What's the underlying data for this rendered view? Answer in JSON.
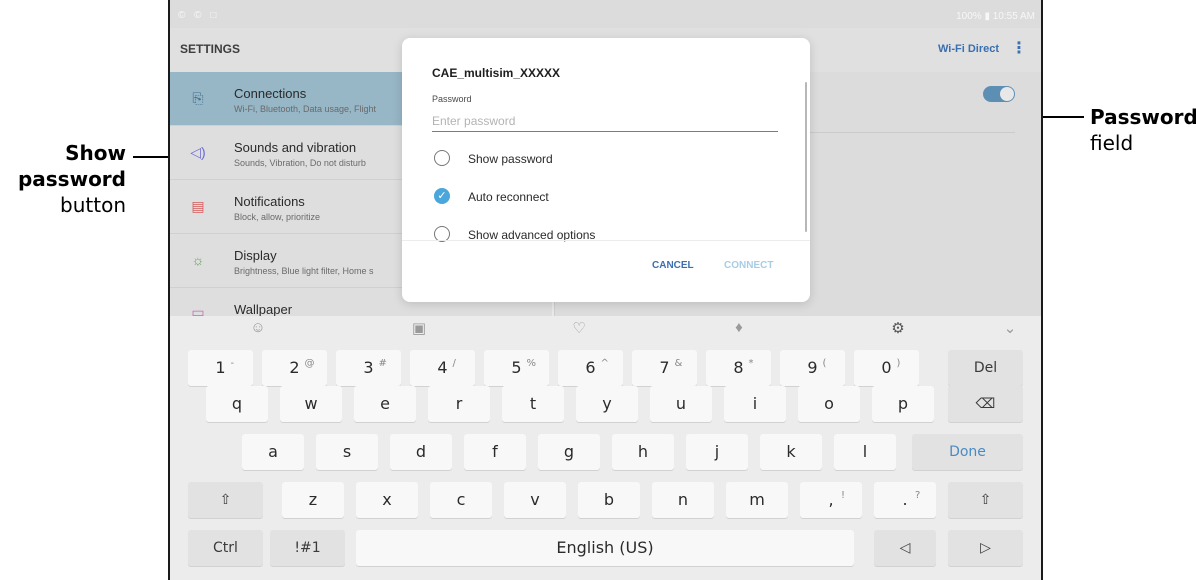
{
  "callouts": {
    "show_password": {
      "bold_line1": "Show",
      "bold_line2": "password",
      "normal": "button"
    },
    "password_field": {
      "bold": "Password",
      "normal": "field"
    }
  },
  "status_bar": {
    "left_icons": "© © □",
    "right": "100% ▮ 10:55 AM"
  },
  "settings": {
    "title": "SETTINGS",
    "wifi_direct": "Wi-Fi Direct",
    "items": [
      {
        "title": "Connections",
        "subtitle": "Wi-Fi, Bluetooth, Data usage, Flight",
        "icon": "connections-icon"
      },
      {
        "title": "Sounds and vibration",
        "subtitle": "Sounds, Vibration, Do not disturb",
        "icon": "speaker-icon"
      },
      {
        "title": "Notifications",
        "subtitle": "Block, allow, prioritize",
        "icon": "notifications-icon"
      },
      {
        "title": "Display",
        "subtitle": "Brightness, Blue light filter, Home s",
        "icon": "display-icon"
      },
      {
        "title": "Wallpaper",
        "subtitle": "",
        "icon": "wallpaper-icon"
      }
    ]
  },
  "dialog": {
    "network": "CAE_multisim_XXXXX",
    "password_label": "Password",
    "password_placeholder": "Enter password",
    "options": [
      {
        "label": "Show password",
        "checked": false
      },
      {
        "label": "Auto reconnect",
        "checked": true
      },
      {
        "label": "Show advanced options",
        "checked": false
      }
    ],
    "cancel": "CANCEL",
    "connect": "CONNECT"
  },
  "keyboard": {
    "number_row": [
      {
        "k": "1",
        "s": "-"
      },
      {
        "k": "2",
        "s": "@"
      },
      {
        "k": "3",
        "s": "#"
      },
      {
        "k": "4",
        "s": "/"
      },
      {
        "k": "5",
        "s": "%"
      },
      {
        "k": "6",
        "s": "^"
      },
      {
        "k": "7",
        "s": "&"
      },
      {
        "k": "8",
        "s": "*"
      },
      {
        "k": "9",
        "s": "("
      },
      {
        "k": "0",
        "s": ")"
      }
    ],
    "del": "Del",
    "row_q": [
      "q",
      "w",
      "e",
      "r",
      "t",
      "y",
      "u",
      "i",
      "o",
      "p"
    ],
    "row_a": [
      "a",
      "s",
      "d",
      "f",
      "g",
      "h",
      "j",
      "k",
      "l"
    ],
    "done": "Done",
    "row_z": [
      "z",
      "x",
      "c",
      "v",
      "b",
      "n",
      "m"
    ],
    "comma": {
      "k": ",",
      "s": "!"
    },
    "period": {
      "k": ".",
      "s": "?"
    },
    "ctrl": "Ctrl",
    "symbols": "!#1",
    "space": "English (US)"
  }
}
